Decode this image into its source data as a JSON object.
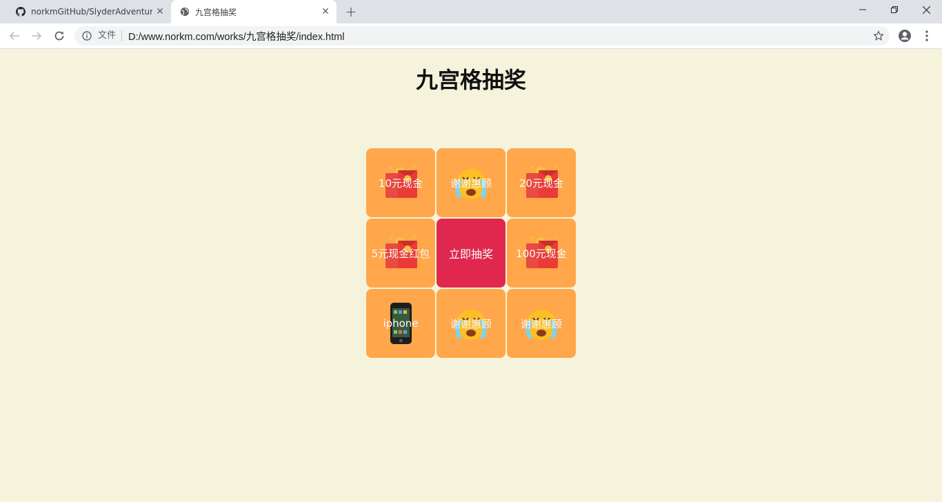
{
  "browser": {
    "tabs": [
      {
        "title": "norkmGitHub/SlyderAdventures",
        "icon": "github-icon",
        "active": false
      },
      {
        "title": "九宫格抽奖",
        "icon": "globe-icon",
        "active": true
      }
    ],
    "address": {
      "security_chip": "文件",
      "url": "D:/www.norkm.com/works/九宫格抽奖/index.html"
    }
  },
  "page": {
    "title": "九宫格抽奖",
    "start_button": "立即抽奖",
    "prizes": [
      {
        "label": "10元现金",
        "art": "red-envelope"
      },
      {
        "label": "谢谢惠顾",
        "art": "crying-face"
      },
      {
        "label": "20元现金",
        "art": "red-envelope"
      },
      {
        "label": "5元现金红包",
        "art": "red-envelope"
      },
      {
        "label": "100元现金",
        "art": "red-envelope"
      },
      {
        "label": "iphone",
        "art": "phone"
      },
      {
        "label": "谢谢惠顾",
        "art": "crying-face"
      },
      {
        "label": "谢谢惠顾",
        "art": "crying-face"
      }
    ]
  },
  "colors": {
    "background": "#f5f3dc",
    "cell": "#ffa74a",
    "start_button": "#e0284e"
  }
}
